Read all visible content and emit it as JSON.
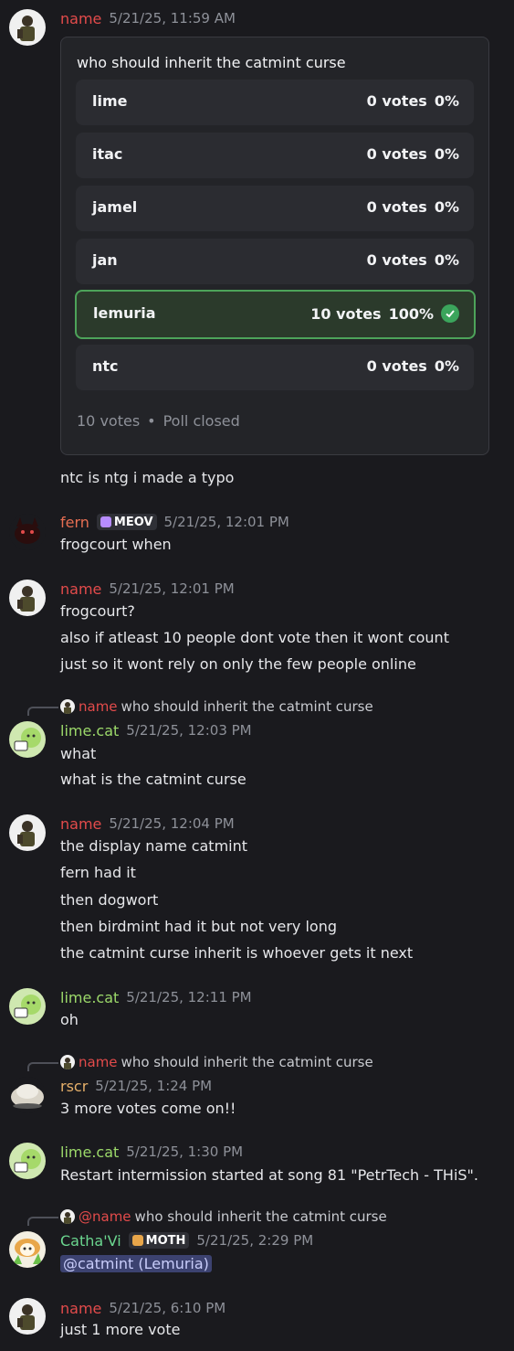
{
  "poll": {
    "question": "who should inherit the catmint curse",
    "options": [
      {
        "label": "lime",
        "votes": "0 votes",
        "pct": "0%"
      },
      {
        "label": "itac",
        "votes": "0 votes",
        "pct": "0%"
      },
      {
        "label": "jamel",
        "votes": "0 votes",
        "pct": "0%"
      },
      {
        "label": "jan",
        "votes": "0 votes",
        "pct": "0%"
      },
      {
        "label": "lemuria",
        "votes": "10 votes",
        "pct": "100%"
      },
      {
        "label": "ntc",
        "votes": "0 votes",
        "pct": "0%"
      }
    ],
    "total": "10 votes",
    "dot": "•",
    "status": "Poll closed"
  },
  "messages": [
    {
      "author": "name",
      "time": "5/21/25, 11:59 AM",
      "lines": [
        "ntc is ntg i made a typo"
      ]
    },
    {
      "author": "fern",
      "tag": "MEOV",
      "time": "5/21/25, 12:01 PM",
      "lines": [
        "frogcourt when"
      ]
    },
    {
      "author": "name",
      "time": "5/21/25, 12:01 PM",
      "lines": [
        "frogcourt?",
        "also if atleast 10 people dont vote then it wont count",
        "just so it wont rely on only the few people online"
      ]
    },
    {
      "reply_author": "name",
      "reply_text": "who should inherit the catmint curse",
      "author": "lime.cat",
      "time": "5/21/25, 12:03 PM",
      "lines": [
        "what",
        "what is the catmint curse"
      ]
    },
    {
      "author": "name",
      "time": "5/21/25, 12:04 PM",
      "lines": [
        "the display name catmint",
        "fern had it",
        "then dogwort",
        "then birdmint had it but not very long",
        "the catmint curse inherit is whoever gets it next"
      ]
    },
    {
      "author": "lime.cat",
      "time": "5/21/25, 12:11 PM",
      "lines": [
        "oh"
      ]
    },
    {
      "reply_author": "name",
      "reply_text": "who should inherit the catmint curse",
      "author": "rscr",
      "time": "5/21/25, 1:24 PM",
      "lines": [
        "3 more votes come on!!"
      ]
    },
    {
      "author": "lime.cat",
      "time": "5/21/25, 1:30 PM",
      "lines": [
        "Restart intermission started at song 81 \"PetrTech - THiS\"."
      ]
    },
    {
      "reply_author": "@name",
      "reply_text": "who should inherit the catmint curse",
      "author": "Catha'Vi",
      "tag": "MOTH",
      "time": "5/21/25, 2:29 PM",
      "lines": [
        "@catmint (Lemuria)"
      ]
    },
    {
      "author": "name",
      "time": "5/21/25, 6:10 PM",
      "lines": [
        "just 1 more vote"
      ]
    }
  ],
  "colors": {
    "name": "#e34b4b",
    "lime": "#9cd96a",
    "fern": "#e66e52",
    "rscr": "#e6b06a",
    "catha": "#6bd68f",
    "win_border": "#4da35a"
  }
}
